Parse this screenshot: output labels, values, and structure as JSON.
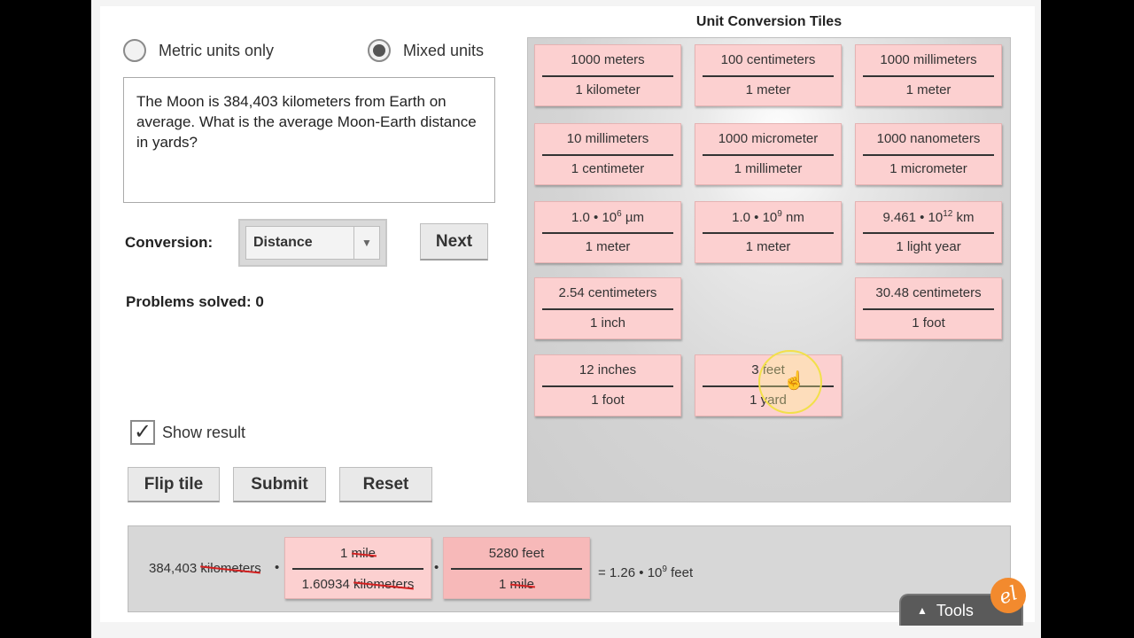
{
  "mode": {
    "metric_label": "Metric units only",
    "mixed_label": "Mixed units",
    "selected": "mixed"
  },
  "question": "The Moon is 384,403 kilometers from Earth on average. What is the average Moon-Earth distance in yards?",
  "conversion": {
    "label": "Conversion:",
    "selected": "Distance",
    "next_label": "Next"
  },
  "problems_solved": "Problems solved: 0",
  "show_result": {
    "label": "Show result",
    "checked": true
  },
  "buttons": {
    "flip": "Flip tile",
    "submit": "Submit",
    "reset": "Reset"
  },
  "tiles_title": "Unit Conversion Tiles",
  "tiles": {
    "t1": {
      "num": "1000 meters",
      "den": "1 kilometer"
    },
    "t2": {
      "num": "100 centimeters",
      "den": "1 meter"
    },
    "t3": {
      "num": "1000 millimeters",
      "den": "1 meter"
    },
    "t4": {
      "num": "10 millimeters",
      "den": "1 centimeter"
    },
    "t5": {
      "num": "1000 micrometer",
      "den": "1 millimeter"
    },
    "t6": {
      "num": "1000 nanometers",
      "den": "1 micrometer"
    },
    "t7": {
      "num_a": "1.0 • 10",
      "num_exp": "6",
      "num_b": " µm",
      "den": "1 meter"
    },
    "t8": {
      "num_a": "1.0 • 10",
      "num_exp": "9",
      "num_b": " nm",
      "den": "1 meter"
    },
    "t9": {
      "num_a": "9.461 • 10",
      "num_exp": "12",
      "num_b": " km",
      "den": "1 light year"
    },
    "t10": {
      "num": "2.54 centimeters",
      "den": "1 inch"
    },
    "t11": {
      "num": "30.48 centimeters",
      "den": "1 foot"
    },
    "t12": {
      "num": "12 inches",
      "den": "1 foot"
    },
    "t13": {
      "num": "3 feet",
      "den": "1 yard"
    }
  },
  "result": {
    "start_value": "384,403",
    "start_unit": "kilometers",
    "dot": "•",
    "tile1": {
      "num_value": "1",
      "num_unit": "mile",
      "den_value": "1.60934",
      "den_unit": "kilometers"
    },
    "tile2": {
      "num": "5280 feet",
      "den_value": "1",
      "den_unit": "mile"
    },
    "answer_a": "= 1.26 • 10",
    "answer_exp": "9",
    "answer_b": " feet"
  },
  "tools_label": "Tools",
  "logo_text": "el"
}
